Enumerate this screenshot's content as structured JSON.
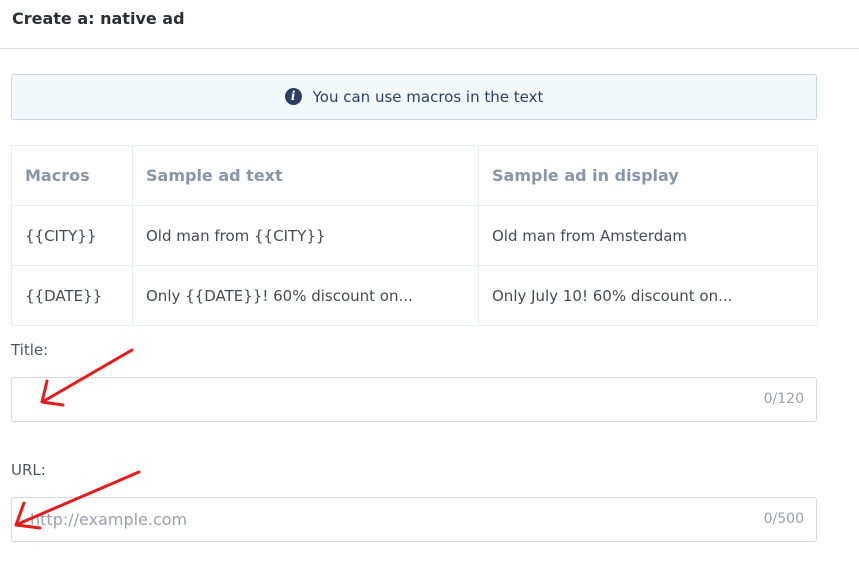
{
  "header": {
    "title": "Create a: native ad"
  },
  "info": {
    "icon": "info-icon",
    "text": "You can use macros in the text"
  },
  "table": {
    "headers": [
      "Macros",
      "Sample ad text",
      "Sample ad in display"
    ],
    "rows": [
      [
        "{{CITY}}",
        "Old man from {{CITY}}",
        "Old man from Amsterdam"
      ],
      [
        "{{DATE}}",
        "Only {{DATE}}! 60% discount on...",
        "Only July 10! 60% discount on..."
      ]
    ]
  },
  "title_field": {
    "label": "Title:",
    "value": "",
    "placeholder": "",
    "counter": "0/120"
  },
  "url_field": {
    "label": "URL:",
    "value": "",
    "placeholder": "http://example.com",
    "counter": "0/500"
  },
  "annotations": {
    "arrow_color": "#e8191a"
  }
}
